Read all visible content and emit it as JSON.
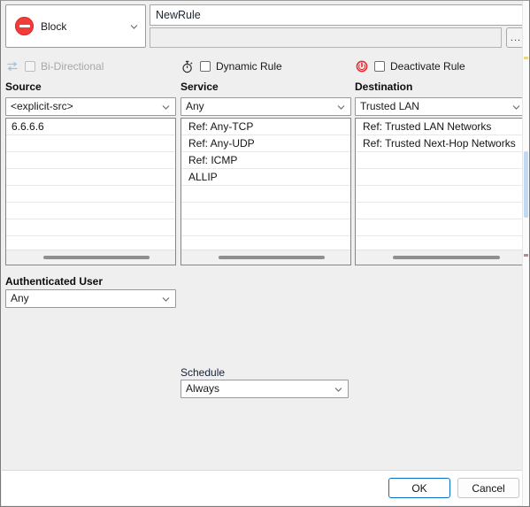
{
  "dialog": {
    "action": {
      "label": "Block",
      "icon": "block-icon",
      "caret": "chevron-down-icon"
    },
    "rule_name": {
      "value": "NewRule",
      "placeholder": ""
    },
    "comment": {
      "value": "",
      "placeholder": ""
    },
    "ellipsis_button": {
      "label": "..."
    }
  },
  "options": {
    "bi_directional": {
      "label": "Bi-Directional",
      "icon": "bi-directional-arrows-icon",
      "checked": false,
      "disabled": true
    },
    "dynamic_rule": {
      "label": "Dynamic Rule",
      "icon": "stopwatch-icon",
      "checked": false,
      "disabled": false
    },
    "deactivate_rule": {
      "label": "Deactivate Rule",
      "icon": "power-icon",
      "checked": false,
      "disabled": false
    }
  },
  "columns": {
    "source": {
      "header": "Source",
      "selected": "<explicit-src>",
      "items": [
        "6.6.6.6"
      ]
    },
    "service": {
      "header": "Service",
      "selected": "Any",
      "items": [
        "Ref: Any-TCP",
        "Ref: Any-UDP",
        "Ref: ICMP",
        "ALLIP"
      ]
    },
    "destination": {
      "header": "Destination",
      "selected": "Trusted LAN",
      "items": [
        "Ref: Trusted LAN Networks",
        "Ref: Trusted Next-Hop Networks"
      ]
    }
  },
  "authenticated_user": {
    "label": "Authenticated User",
    "selected": "Any"
  },
  "schedule": {
    "label": "Schedule",
    "selected": "Always"
  },
  "footer": {
    "ok_label": "OK",
    "cancel_label": "Cancel"
  },
  "colors": {
    "block_red": "#f13c3c",
    "power_red": "#e8252a",
    "focus_blue": "#0a6ec7",
    "dialog_bg": "#efefef",
    "scroll_thumb_blue": "#c3d9ef"
  }
}
